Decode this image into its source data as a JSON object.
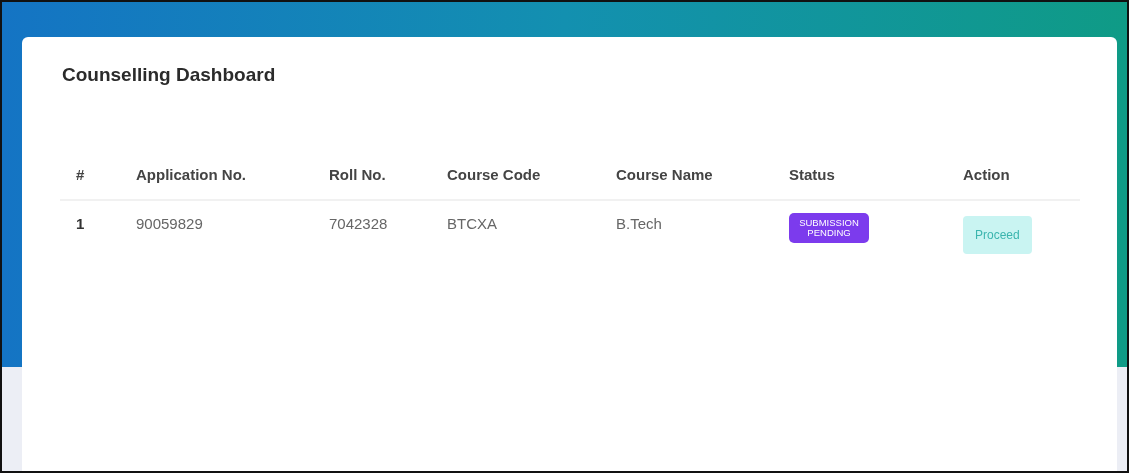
{
  "title": "Counselling Dashboard",
  "table": {
    "columns": [
      "#",
      "Application No.",
      "Roll No.",
      "Course Code",
      "Course Name",
      "Status",
      "Action"
    ],
    "rows": [
      {
        "index": "1",
        "application_no": "90059829",
        "roll_no": "7042328",
        "course_code": "BTCXA",
        "course_name": "B.Tech",
        "status": "SUBMISSION PENDING",
        "action": "Proceed"
      }
    ]
  }
}
